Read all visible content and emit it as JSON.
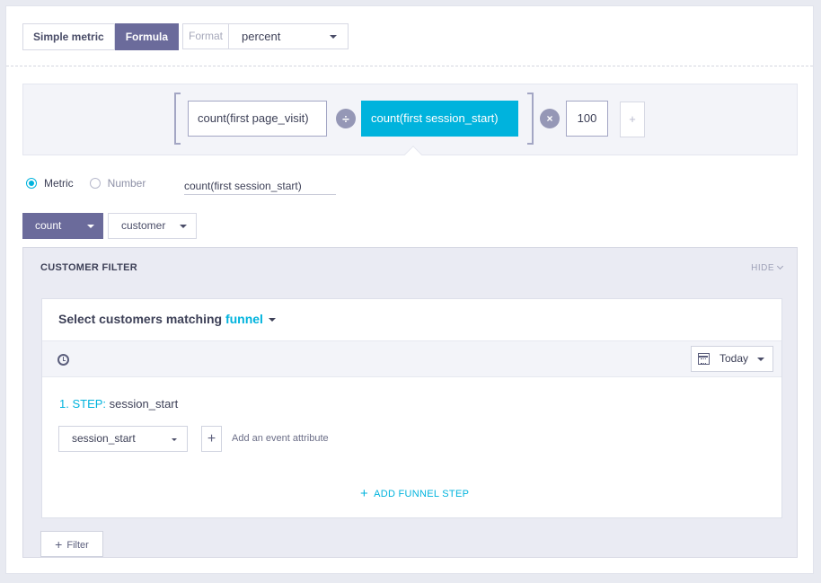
{
  "mode_toggle": {
    "simple_label": "Simple metric",
    "formula_label": "Formula",
    "active": "Formula"
  },
  "format": {
    "label": "Format",
    "value": "percent"
  },
  "formula": {
    "term1": "count(first page_visit)",
    "operator1": "÷",
    "term2": "count(first session_start)",
    "operator2": "×",
    "term3": "100",
    "add": "+"
  },
  "operand_type": {
    "metric_label": "Metric",
    "number_label": "Number",
    "selected": "Metric",
    "metric_value": "count(first session_start)"
  },
  "aggregation": {
    "function": "count",
    "entity": "customer"
  },
  "customer_filter": {
    "title": "CUSTOMER FILTER",
    "hide_label": "HIDE",
    "heading_prefix": "Select customers matching",
    "heading_mode": "funnel",
    "time_range": "Today",
    "step_number": "1. STEP:",
    "step_name": "session_start",
    "event_select": "session_start",
    "add_attribute_label": "Add an event attribute",
    "add_step_label": "ADD FUNNEL STEP",
    "filter_button": "Filter"
  },
  "colors": {
    "accent_cyan": "#00b3dd",
    "accent_purple": "#6b6b9b",
    "operator_grey": "#9597b6"
  }
}
